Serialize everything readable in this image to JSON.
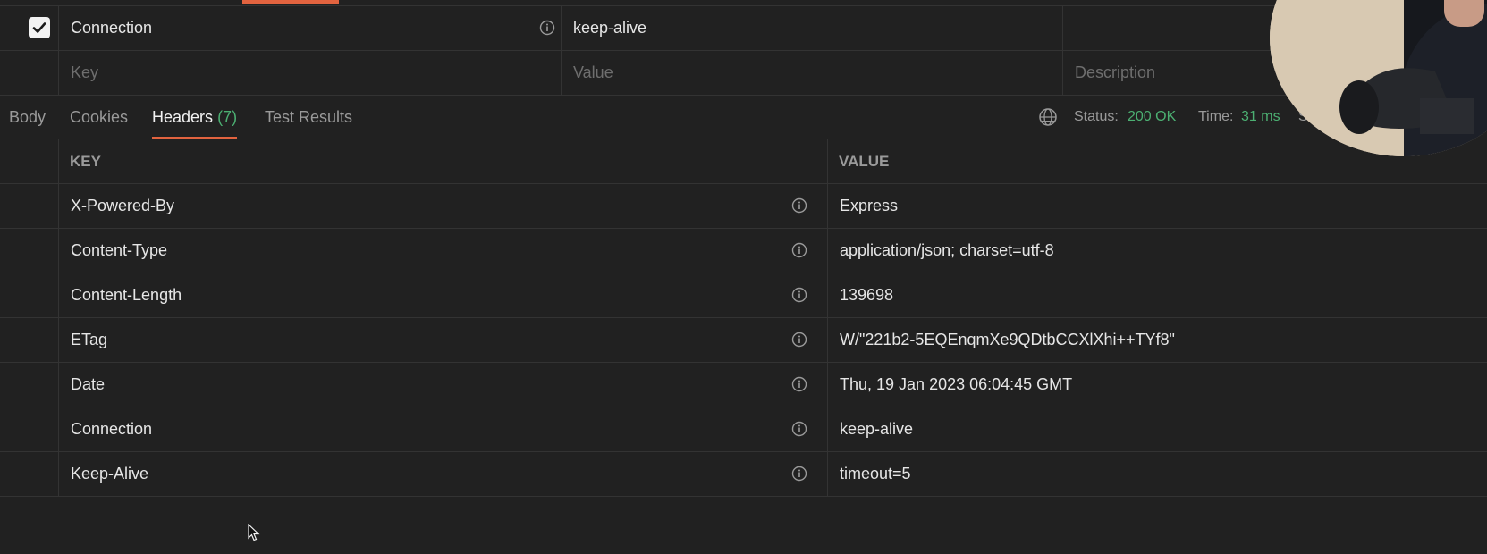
{
  "request_headers": {
    "rows": [
      {
        "checked": true,
        "key": "Connection",
        "value": "keep-alive",
        "description": ""
      }
    ],
    "placeholders": {
      "key": "Key",
      "value": "Value",
      "description": "Description"
    }
  },
  "response_tabs": [
    {
      "label": "Body"
    },
    {
      "label": "Cookies"
    },
    {
      "label": "Headers",
      "count": "(7)",
      "active": true
    },
    {
      "label": "Test Results"
    }
  ],
  "status_bar": {
    "status_label": "Status:",
    "status_value": "200 OK",
    "time_label": "Time:",
    "time_value": "31 ms",
    "size_label": "Size:"
  },
  "response_headers": {
    "columns": {
      "key": "KEY",
      "value": "VALUE"
    },
    "rows": [
      {
        "key": "X-Powered-By",
        "value": "Express"
      },
      {
        "key": "Content-Type",
        "value": "application/json; charset=utf-8"
      },
      {
        "key": "Content-Length",
        "value": "139698"
      },
      {
        "key": "ETag",
        "value": "W/\"221b2-5EQEnqmXe9QDtbCCXlXhi++TYf8\""
      },
      {
        "key": "Date",
        "value": "Thu, 19 Jan 2023 06:04:45 GMT"
      },
      {
        "key": "Connection",
        "value": "keep-alive"
      },
      {
        "key": "Keep-Alive",
        "value": "timeout=5"
      }
    ]
  },
  "colors": {
    "background": "#212121",
    "accent": "#e2633f",
    "success": "#4caf72"
  },
  "icons": [
    "checkbox-checked-icon",
    "info-icon",
    "globe-icon",
    "mouse-cursor-icon"
  ]
}
